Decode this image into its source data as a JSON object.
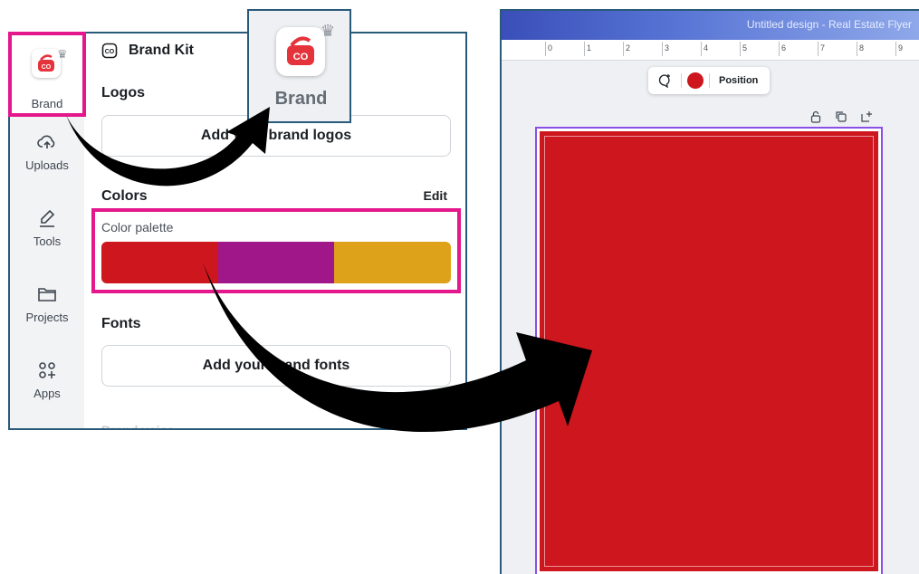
{
  "rail": {
    "brand_label": "Brand",
    "uploads_label": "Uploads",
    "tools_label": "Tools",
    "projects_label": "Projects",
    "apps_label": "Apps"
  },
  "panel": {
    "title": "Brand Kit",
    "logos_heading": "Logos",
    "add_logos_label": "Add your brand logos",
    "colors_heading": "Colors",
    "edit_label": "Edit",
    "palette_label": "Color palette",
    "palette": [
      "#cd161d",
      "#a0178a",
      "#dea11a"
    ],
    "fonts_heading": "Fonts",
    "add_fonts_label": "Add your brand fonts",
    "next_heading": "Brand voice"
  },
  "callout": {
    "label": "Brand"
  },
  "brand_tile_text": "CO",
  "editor": {
    "doc_title": "Untitled design - Real Estate Flyer",
    "ruler_ticks": [
      "0",
      "1",
      "2",
      "3",
      "4",
      "5",
      "6",
      "7",
      "8",
      "9"
    ],
    "toolbar_color": "#cd161d",
    "position_label": "Position",
    "page_color": "#cd161d"
  },
  "colors": {
    "highlight": "#e4178c",
    "panel_border": "#2a5a79",
    "selection": "#8a4fe8"
  }
}
